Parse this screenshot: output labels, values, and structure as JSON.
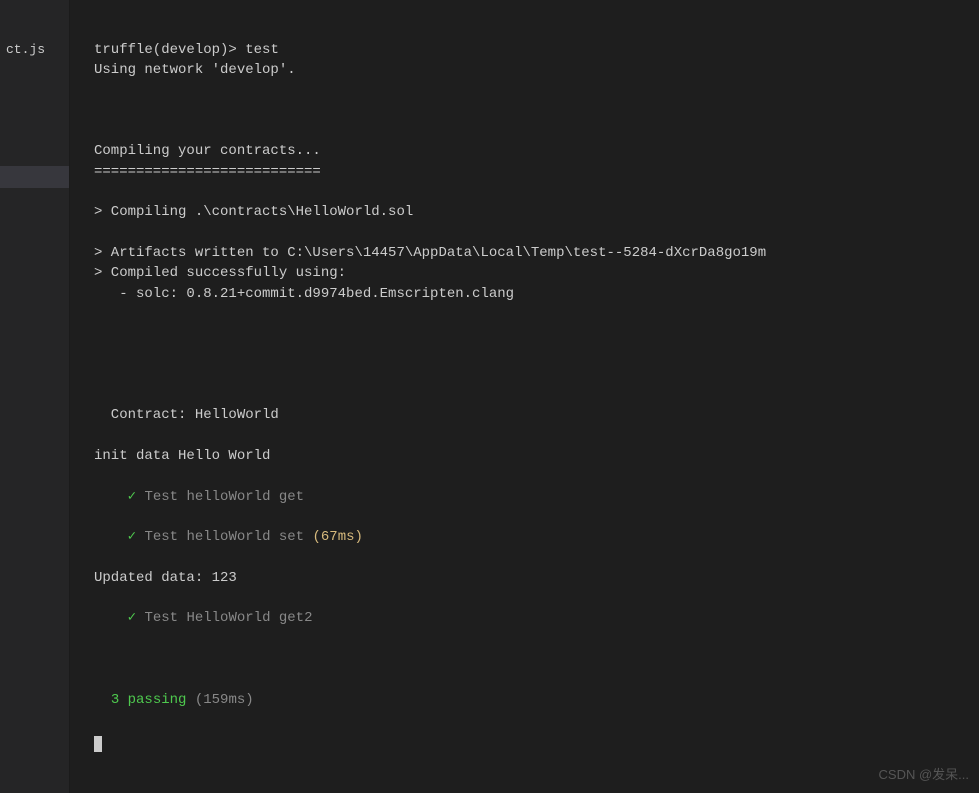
{
  "sidebar": {
    "file_label": "ct.js"
  },
  "terminal": {
    "prompt": "truffle(develop)> ",
    "command": "test",
    "using_network": "Using network 'develop'.",
    "compiling_header": "Compiling your contracts...",
    "compiling_sep": "===========================",
    "compile_line": "> Compiling .\\contracts\\HelloWorld.sol",
    "artifacts_line": "> Artifacts written to C:\\Users\\14457\\AppData\\Local\\Temp\\test--5284-dXcrDa8go19m",
    "compiled_line": "> Compiled successfully using:",
    "solc_line": "   - solc: 0.8.21+commit.d9974bed.Emscripten.clang",
    "contract_header": "  Contract: HelloWorld",
    "init_data": "init data Hello World",
    "test1": {
      "check": "✓",
      "label": " Test helloWorld get"
    },
    "test2": {
      "check": "✓",
      "label": " Test helloWorld set ",
      "time": "(67ms)"
    },
    "updated_data": "Updated data: 123",
    "test3": {
      "check": "✓",
      "label": " Test HelloWorld get2"
    },
    "passing": {
      "count": "3",
      "text": " passing",
      "time": " (159ms)"
    }
  },
  "watermark": "CSDN @发呆..."
}
